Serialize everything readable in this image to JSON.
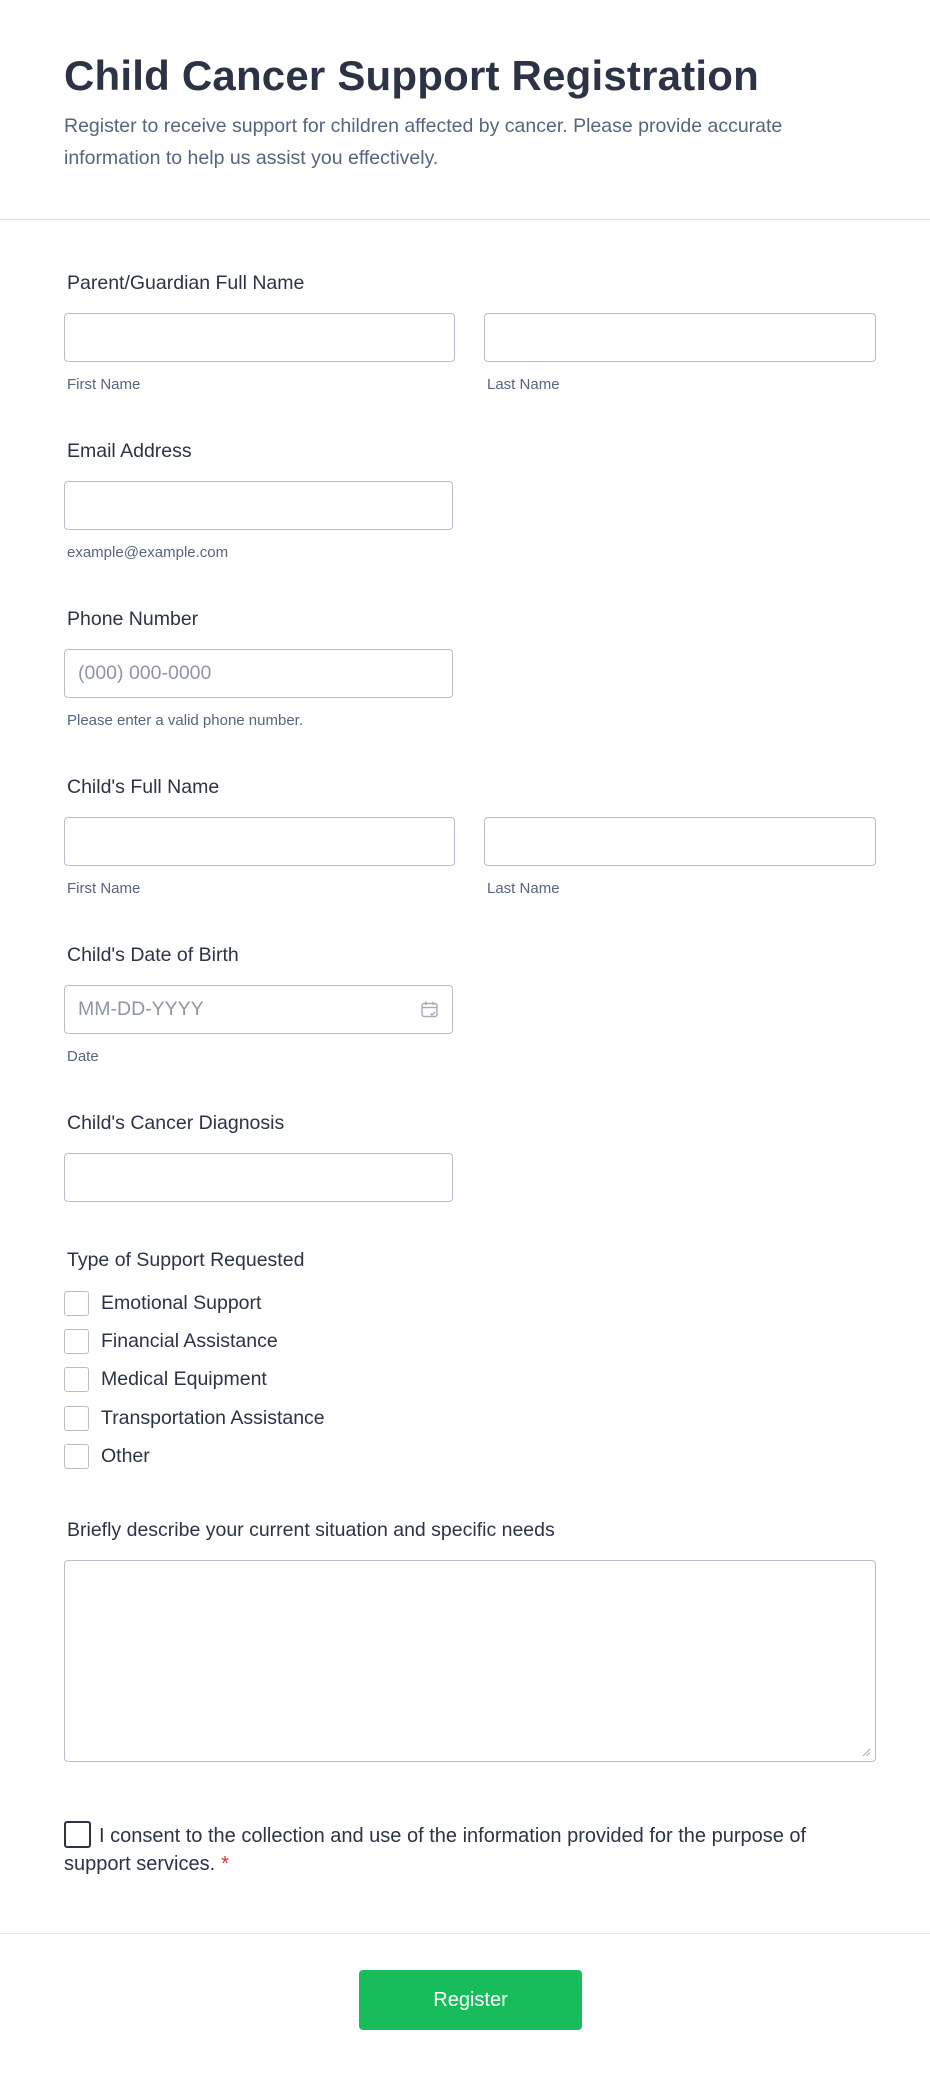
{
  "header": {
    "title": "Child Cancer Support Registration",
    "subtitle": "Register to receive support for children affected by cancer. Please provide accurate information to help us assist you effectively."
  },
  "parent_name": {
    "label": "Parent/Guardian Full Name",
    "first_sub": "First Name",
    "last_sub": "Last Name"
  },
  "email": {
    "label": "Email Address",
    "sub": "example@example.com"
  },
  "phone": {
    "label": "Phone Number",
    "placeholder": "(000) 000-0000",
    "sub": "Please enter a valid phone number."
  },
  "child_name": {
    "label": "Child's Full Name",
    "first_sub": "First Name",
    "last_sub": "Last Name"
  },
  "dob": {
    "label": "Child's Date of Birth",
    "placeholder": "MM-DD-YYYY",
    "sub": "Date",
    "icon": "calendar-icon"
  },
  "diagnosis": {
    "label": "Child's Cancer Diagnosis"
  },
  "support": {
    "label": "Type of Support Requested",
    "options": [
      "Emotional Support",
      "Financial Assistance",
      "Medical Equipment",
      "Transportation Assistance",
      "Other"
    ]
  },
  "needs": {
    "label": "Briefly describe your current situation and specific needs"
  },
  "consent": {
    "text": "I consent to the collection and use of the information provided for the purpose of support services.",
    "required_mark": "*"
  },
  "footer": {
    "submit_label": "Register"
  },
  "colors": {
    "accent": "#18bd5b",
    "required": "#e32b2b",
    "text": "#2c3345",
    "muted": "#57647e"
  }
}
